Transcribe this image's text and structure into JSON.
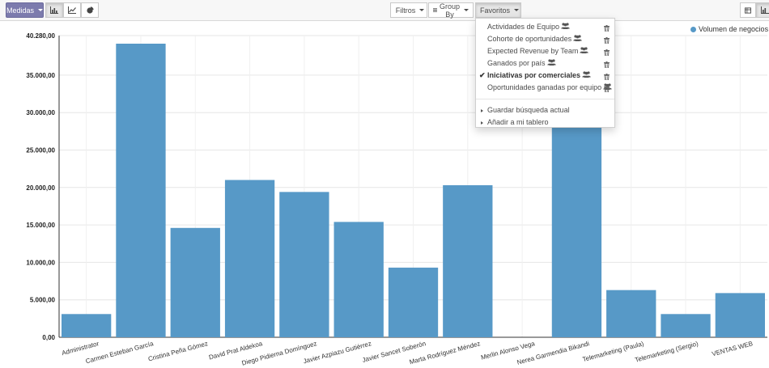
{
  "toolbar": {
    "measures_label": "Medidas",
    "filters_label": "Filtros",
    "groupby_label": "Group By",
    "favorites_label": "Favoritos",
    "accent": "#7c7bad"
  },
  "favorites_menu": {
    "items": [
      {
        "label": "Actividades de Equipo",
        "selected": false
      },
      {
        "label": "Cohorte de oportunidades",
        "selected": false
      },
      {
        "label": "Expected Revenue by Team",
        "selected": false
      },
      {
        "label": "Ganados por país",
        "selected": false
      },
      {
        "label": "Iniciativas por comerciales",
        "selected": true
      },
      {
        "label": "Oportunidades ganadas por equipo",
        "selected": false
      }
    ],
    "save_label": "Guardar búsqueda actual",
    "dashboard_label": "Añadir a mi tablero"
  },
  "chart_data": {
    "type": "bar",
    "categories": [
      "Administrator",
      "Carmen Esteban García",
      "Cristina Peña Gómez",
      "David Prat Aldekoa",
      "Diego Pidierna Domínguez",
      "Javier Azpiazu Gutiérrez",
      "Javier Sancet Soberón",
      "Marta Rodríguez Méndez",
      "Merlin Alonso Vega",
      "Nerea Garmendia Bikandi",
      "Telemarketing (Paula)",
      "Telemarketing (Sergio)",
      "VENTAS WEB"
    ],
    "series": [
      {
        "name": "Volumen de negocios ...",
        "values": [
          3100,
          39200,
          14600,
          21000,
          19400,
          15400,
          9300,
          20300,
          0,
          28500,
          6300,
          3100,
          5900
        ]
      }
    ],
    "yticks": [
      "0,00",
      "5.000,00",
      "10.000,00",
      "15.000,00",
      "20.000,00",
      "25.000,00",
      "30.000,00",
      "35.000,00",
      "40.280,00"
    ],
    "ylim": [
      0,
      40280
    ],
    "grid": true,
    "legend": "top-right",
    "bar_color": "#5799c7"
  }
}
